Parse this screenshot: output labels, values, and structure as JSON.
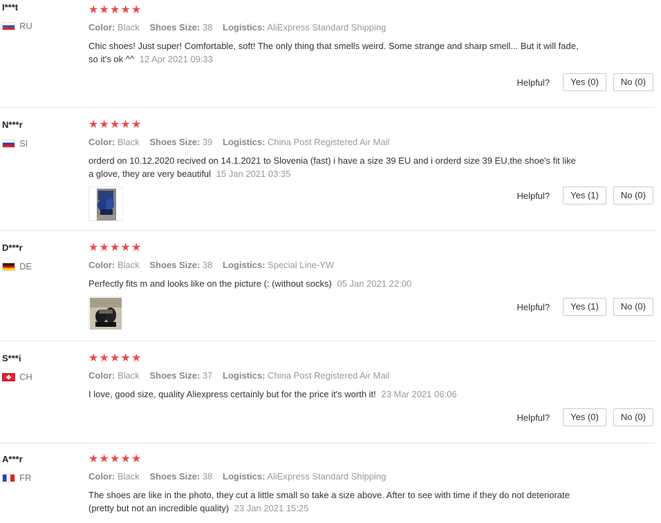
{
  "helpful_label": "Helpful?",
  "reviews": [
    {
      "user": "I***t",
      "country": "RU",
      "rating": 5,
      "color_label": "Color:",
      "color": "Black",
      "size_label": "Shoes Size:",
      "size": "38",
      "logistics_label": "Logistics:",
      "logistics": "AliExpress Standard Shipping",
      "text": "Chic shoes! Just super! Comfortable, soft! The only thing that smells weird. Some strange and sharp smell... But it will fade, so it's ok ^^",
      "date": "12 Apr 2021 09:33",
      "yes": "Yes (0)",
      "no": "No (0)"
    },
    {
      "user": "N***r",
      "country": "SI",
      "rating": 5,
      "color_label": "Color:",
      "color": "Black",
      "size_label": "Shoes Size:",
      "size": "39",
      "logistics_label": "Logistics:",
      "logistics": "China Post Registered Air Mail",
      "text": "orderd on 10.12.2020 recived on 14.1.2021 to Slovenia (fast) i have a size 39 EU and i orderd size 39 EU,the shoe's fit like a glove, they are very beautiful",
      "date": "15 Jan 2021 03:35",
      "yes": "Yes (1)",
      "no": "No (0)"
    },
    {
      "user": "D***r",
      "country": "DE",
      "rating": 5,
      "color_label": "Color:",
      "color": "Black",
      "size_label": "Shoes Size:",
      "size": "38",
      "logistics_label": "Logistics:",
      "logistics": "Special Line-YW",
      "text": "Perfectly fits m and looks like on the picture (: (without socks)",
      "date": "05 Jan 2021 22:00",
      "yes": "Yes (1)",
      "no": "No (0)"
    },
    {
      "user": "S***i",
      "country": "CH",
      "rating": 5,
      "color_label": "Color:",
      "color": "Black",
      "size_label": "Shoes Size:",
      "size": "37",
      "logistics_label": "Logistics:",
      "logistics": "China Post Registered Air Mail",
      "text": "I love, good size, quality Aliexpress certainly but for the price it's worth it!",
      "date": "23 Mar 2021 06:06",
      "yes": "Yes (0)",
      "no": "No (0)"
    },
    {
      "user": "A***r",
      "country": "FR",
      "rating": 5,
      "color_label": "Color:",
      "color": "Black",
      "size_label": "Shoes Size:",
      "size": "38",
      "logistics_label": "Logistics:",
      "logistics": "AliExpress Standard Shipping",
      "text": "The shoes are like in the photo, they cut a little small so take a size above. After to see with time if they do not deteriorate (pretty but not an incredible quality)",
      "date": "23 Jan 2021 15:25"
    }
  ],
  "colors": {
    "star": "#f04848",
    "muted": "#999999",
    "divider": "#e6e6e6"
  }
}
